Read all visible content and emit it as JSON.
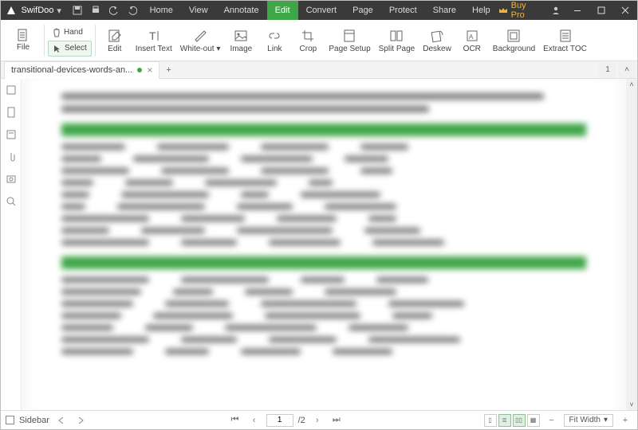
{
  "app": {
    "name": "SwifDoo"
  },
  "titlebar": {
    "buy_pro": "Buy Pro"
  },
  "menu": {
    "items": [
      "Home",
      "View",
      "Annotate",
      "Edit",
      "Convert",
      "Page",
      "Protect",
      "Share",
      "Help"
    ],
    "active_index": 3
  },
  "ribbon": {
    "file": "File",
    "hand": "Hand",
    "select": "Select",
    "items": [
      "Edit",
      "Insert Text",
      "White-out",
      "Image",
      "Link",
      "Crop",
      "Page Setup",
      "Split Page",
      "Deskew",
      "OCR",
      "Background",
      "Extract TOC"
    ]
  },
  "tab": {
    "filename": "transitional-devices-words-an...",
    "tab_number": "1"
  },
  "status": {
    "sidebar_label": "Sidebar",
    "page_current": "1",
    "page_total": "/2",
    "fit_label": "Fit Width"
  },
  "colors": {
    "accent": "#3fa648",
    "titlebar": "#3a3a3a"
  }
}
